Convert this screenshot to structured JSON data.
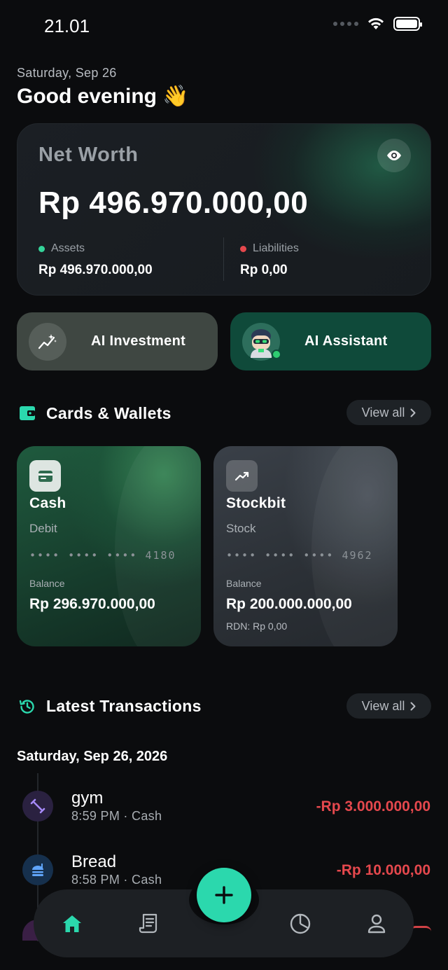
{
  "status_bar": {
    "time": "21.01"
  },
  "header": {
    "date": "Saturday, Sep 26",
    "greeting": "Good evening 👋"
  },
  "net_worth": {
    "title": "Net Worth",
    "amount": "Rp 496.970.000,00",
    "assets_label": "Assets",
    "assets_value": "Rp 496.970.000,00",
    "liabilities_label": "Liabilities",
    "liabilities_value": "Rp 0,00",
    "colors": {
      "assets": "#34d399",
      "liabilities": "#e5484d"
    }
  },
  "ai_buttons": {
    "investment_label": "AI Investment",
    "assistant_label": "AI Assistant"
  },
  "cards_section": {
    "title": "Cards & Wallets",
    "view_all": "View all",
    "cards": [
      {
        "name": "Cash",
        "type": "Debit",
        "masked": "•••• •••• ••••",
        "last4": "4180",
        "balance_label": "Balance",
        "balance": "Rp 296.970.000,00"
      },
      {
        "name": "Stockbit",
        "type": "Stock",
        "masked": "•••• •••• ••••",
        "last4": "4962",
        "balance_label": "Balance",
        "balance": "Rp 200.000.000,00",
        "rdn": "RDN: Rp 0,00"
      }
    ]
  },
  "transactions_section": {
    "title": "Latest Transactions",
    "view_all": "View all",
    "date_group": "Saturday, Sep 26, 2026",
    "items": [
      {
        "name": "gym",
        "meta": "8:59 PM · Cash",
        "amount": "-Rp 3.000.000,00"
      },
      {
        "name": "Bread",
        "meta": "8:58 PM · Cash",
        "amount": "-Rp 10.000,00"
      }
    ]
  },
  "accent_color": "#2bd8ad",
  "negative_color": "#e5484d"
}
